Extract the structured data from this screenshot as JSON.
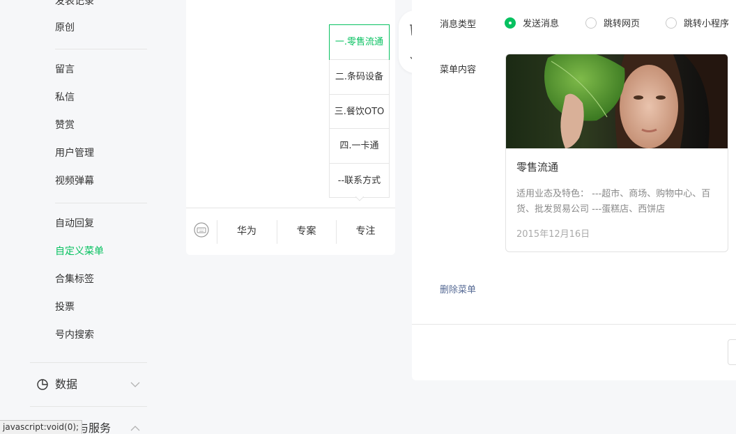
{
  "sidebar": {
    "items_top": [
      {
        "label": "发表记录"
      },
      {
        "label": "原创"
      }
    ],
    "items_interact": [
      {
        "label": "留言"
      },
      {
        "label": "私信"
      },
      {
        "label": "赞赏"
      },
      {
        "label": "用户管理"
      },
      {
        "label": "视频弹幕"
      }
    ],
    "items_func": [
      {
        "label": "自动回复"
      },
      {
        "label": "自定义菜单"
      },
      {
        "label": "合集标签"
      },
      {
        "label": "投票"
      },
      {
        "label": "号内搜索"
      }
    ],
    "active_item": "自定义菜单",
    "groups": [
      {
        "label": "数据",
        "icon": "pie-chart-icon"
      },
      {
        "label": "广告与服务",
        "icon": "ad-icon"
      }
    ]
  },
  "preview": {
    "submenu": [
      {
        "label": "一.零售流通"
      },
      {
        "label": "二.条码设备"
      },
      {
        "label": "三.餐饮OTO"
      },
      {
        "label": "四.一卡通"
      },
      {
        "label": "--联系方式"
      }
    ],
    "bottom_menus": [
      {
        "label": "华为"
      },
      {
        "label": "专案"
      },
      {
        "label": "专注"
      }
    ]
  },
  "editor": {
    "message_type_label": "消息类型",
    "message_types": [
      {
        "label": "发送消息",
        "checked": true
      },
      {
        "label": "跳转网页",
        "checked": false
      },
      {
        "label": "跳转小程序",
        "checked": false
      }
    ],
    "content_label": "菜单内容",
    "card": {
      "title": "零售流通",
      "description": "适用业态及特色： ---超市、商场、购物中心、百货、批发贸易公司 ---蛋糕店、西饼店",
      "date": "2015年12月16日"
    },
    "delete_label": "删除菜单"
  },
  "status_bar": {
    "text": "javascript:void(0);"
  },
  "colors": {
    "accent": "#07c160",
    "link": "#576b95"
  }
}
